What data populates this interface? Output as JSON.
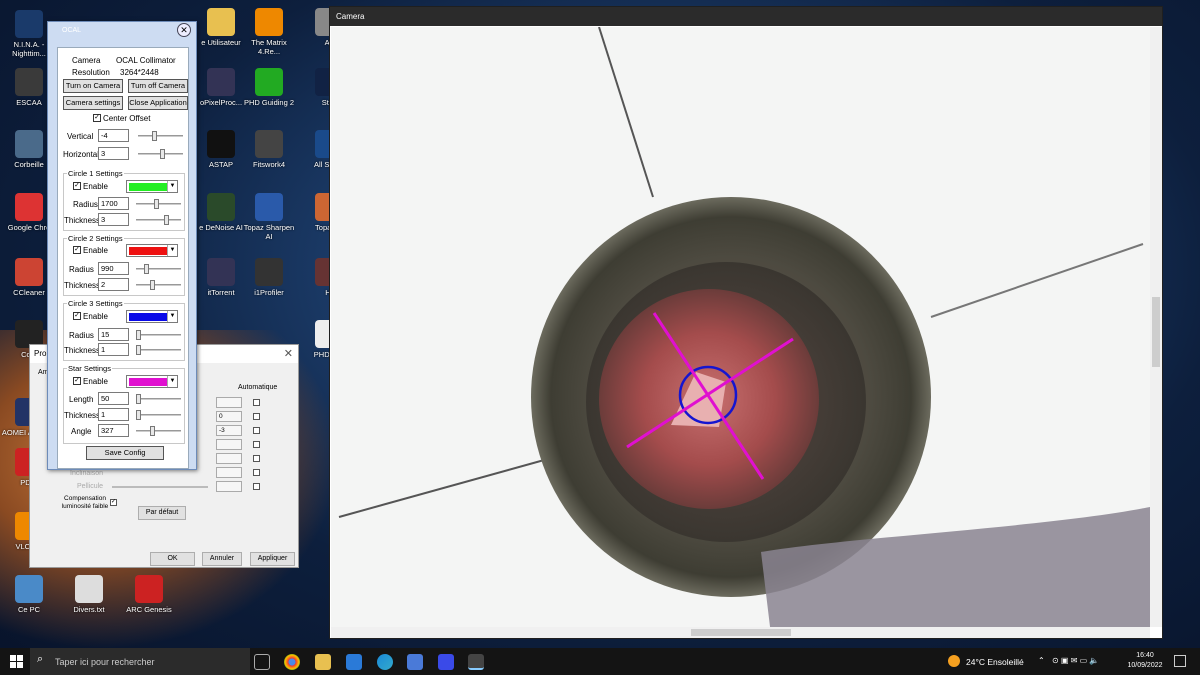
{
  "desktop_icons": [
    {
      "label": "N.I.N.A. - Nighttim...",
      "icon": "nina-icon",
      "color": "#1a3a6a"
    },
    {
      "label": "ESCAA",
      "icon": "escaa-icon",
      "color": "#3a3a3a"
    },
    {
      "label": "Corbeille",
      "icon": "recycle-bin-icon",
      "color": "#4a6a8a"
    },
    {
      "label": "Google Chro",
      "icon": "chrome-icon",
      "color": "#d33"
    },
    {
      "label": "CCleaner",
      "icon": "ccleaner-icon",
      "color": "#c43"
    },
    {
      "label": "Com",
      "icon": "terminal-icon",
      "color": "#222"
    },
    {
      "label": "AOMEI Assistan",
      "icon": "aomei-icon",
      "color": "#236"
    },
    {
      "label": "PDF-",
      "icon": "pdf-icon",
      "color": "#c22"
    },
    {
      "label": "VLC me",
      "icon": "vlc-icon",
      "color": "#e80"
    },
    {
      "label": "Ce PC",
      "icon": "computer-icon",
      "color": "#4a8ac8"
    },
    {
      "label": "Divers.txt",
      "icon": "text-file-icon",
      "color": "#ddd"
    },
    {
      "label": "ARC Genesis",
      "icon": "arc-genesis-icon",
      "color": "#c22"
    },
    {
      "label": "e Utilisateur",
      "icon": "folder-icon",
      "color": "#e8c050"
    },
    {
      "label": "The Matrix 4.Re...",
      "icon": "vlc-file-icon",
      "color": "#e80"
    },
    {
      "label": "As",
      "icon": "generic-icon",
      "color": "#888"
    },
    {
      "label": "oPixelProc...",
      "icon": "pixinsight-icon",
      "color": "#335"
    },
    {
      "label": "PHD Guiding 2",
      "icon": "phd-icon",
      "color": "#2a2"
    },
    {
      "label": "Stell",
      "icon": "stellarium-icon",
      "color": "#124"
    },
    {
      "label": "ASTAP",
      "icon": "astap-icon",
      "color": "#111"
    },
    {
      "label": "Fitswork4",
      "icon": "fitswork-icon",
      "color": "#444"
    },
    {
      "label": "All Sk Sc",
      "icon": "allsky-icon",
      "color": "#1a4a8a"
    },
    {
      "label": "e DeNoise AI",
      "icon": "denoise-icon",
      "color": "#2a4a2a"
    },
    {
      "label": "Topaz Sharpen AI",
      "icon": "sharpen-icon",
      "color": "#2a5aaa"
    },
    {
      "label": "Topaz G",
      "icon": "topaz-icon",
      "color": "#c63"
    },
    {
      "label": "itTorrent",
      "icon": "bittorrent-icon",
      "color": "#335"
    },
    {
      "label": "i1Profiler",
      "icon": "i1profiler-icon",
      "color": "#333"
    },
    {
      "label": "HI",
      "icon": "generic-icon",
      "color": "#633"
    },
    {
      "label": "PHD2 Lo",
      "icon": "phd2-log-icon",
      "color": "#eee"
    }
  ],
  "camera_window": {
    "title": "Camera"
  },
  "properties_dialog": {
    "title": "Prop",
    "tab_partial": "Am",
    "automatique_label": "Automatique",
    "val_1": "0",
    "val_2": "-3",
    "inclinaison": "Inclinaison",
    "pellicule": "Pellicule",
    "compensation": "Compensation luminosité faible",
    "par_defaut": "Par défaut",
    "ok": "OK",
    "annuler": "Annuler",
    "appliquer": "Appliquer"
  },
  "ocal": {
    "title": "OCAL",
    "camera_label": "Camera",
    "camera_value": "OCAL Collimator",
    "resolution_label": "Resolution",
    "resolution_value": "3264*2448",
    "btn_turn_on": "Turn on Camera",
    "btn_turn_off": "Turn off Camera",
    "btn_camera_settings": "Camera settings",
    "btn_close_app": "Close Application",
    "center_offset": "Center Offset",
    "vertical_label": "Vertical",
    "vertical_value": "-4",
    "horizontal_label": "Horizontal",
    "horizontal_value": "3",
    "circle1": {
      "title": "Circle 1 Settings",
      "enable": "Enable",
      "color": "#22ee22",
      "radius_label": "Radius",
      "radius": "1700",
      "thickness_label": "Thickness",
      "thickness": "3"
    },
    "circle2": {
      "title": "Circle 2 Settings",
      "enable": "Enable",
      "color": "#ee1111",
      "radius_label": "Radius",
      "radius": "990",
      "thickness_label": "Thickness",
      "thickness": "2"
    },
    "circle3": {
      "title": "Circle 3 Settings",
      "enable": "Enable",
      "color": "#0a0ae8",
      "radius_label": "Radius",
      "radius": "15",
      "thickness_label": "Thickness",
      "thickness": "1"
    },
    "star": {
      "title": "Star Settings",
      "enable": "Enable",
      "color": "#e010d0",
      "length_label": "Length",
      "length": "50",
      "thickness_label": "Thickness",
      "thickness": "1",
      "angle_label": "Angle",
      "angle": "327"
    },
    "save_config": "Save Config"
  },
  "taskbar": {
    "search_placeholder": "Taper ici pour rechercher",
    "weather": "24°C  Ensoleillé",
    "time": "16:40",
    "date": "10/09/2022"
  }
}
